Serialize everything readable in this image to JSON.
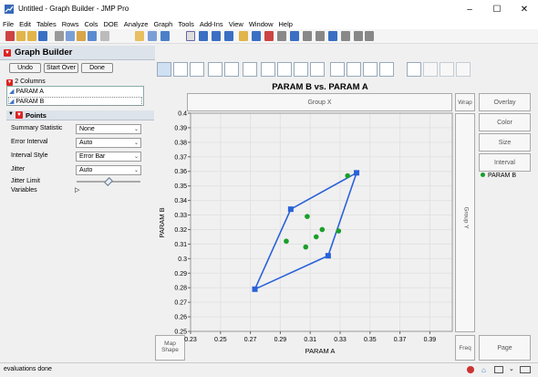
{
  "window": {
    "title": "Untitled - Graph Builder - JMP Pro"
  },
  "menu": [
    "File",
    "Edit",
    "Tables",
    "Rows",
    "Cols",
    "DOE",
    "Analyze",
    "Graph",
    "Tools",
    "Add-Ins",
    "View",
    "Window",
    "Help"
  ],
  "panel": {
    "title": "Graph Builder",
    "buttons": {
      "undo": "Undo",
      "start_over": "Start Over",
      "done": "Done"
    },
    "columns_header": "2 Columns",
    "columns": [
      "PARAM A",
      "PARAM B"
    ],
    "points_header": "Points",
    "options": [
      {
        "label": "Summary Statistic",
        "value": "None"
      },
      {
        "label": "Error Interval",
        "value": "Auto"
      },
      {
        "label": "Interval Style",
        "value": "Error Bar"
      },
      {
        "label": "Jitter",
        "value": "Auto"
      }
    ],
    "jitter_limit_label": "Jitter Limit",
    "jitter_limit": 0.5,
    "variables_label": "Variables"
  },
  "zones": {
    "group_x": "Group X",
    "group_y": "Group Y",
    "wrap": "Wrap",
    "overlay": "Overlay",
    "color": "Color",
    "size": "Size",
    "interval": "Interval",
    "map_shape": "Map Shape",
    "freq": "Freq",
    "page": "Page"
  },
  "legend": [
    {
      "name": "PARAM B",
      "color": "#1a9f2a"
    }
  ],
  "status": {
    "text": "evaluations done"
  },
  "chart_data": {
    "type": "scatter",
    "title": "PARAM B vs. PARAM A",
    "xlabel": "PARAM A",
    "ylabel": "PARAM B",
    "xlim": [
      0.23,
      0.405
    ],
    "ylim": [
      0.25,
      0.4
    ],
    "xticks": [
      "0.23",
      "0.25",
      "0.27",
      "0.29",
      "0.31",
      "0.33",
      "0.35",
      "0.37",
      "0.39"
    ],
    "yticks": [
      "0.25",
      "0.26",
      "0.27",
      "0.28",
      "0.29",
      "0.3",
      "0.31",
      "0.32",
      "0.33",
      "0.34",
      "0.35",
      "0.36",
      "0.37",
      "0.38",
      "0.39",
      "0.4"
    ],
    "grid": true,
    "series": [
      {
        "name": "PARAM B",
        "color": "#1a9f2a",
        "points": [
          [
            0.294,
            0.312
          ],
          [
            0.307,
            0.308
          ],
          [
            0.308,
            0.329
          ],
          [
            0.314,
            0.315
          ],
          [
            0.318,
            0.32
          ],
          [
            0.329,
            0.319
          ],
          [
            0.335,
            0.357
          ]
        ]
      }
    ],
    "hull": {
      "color": "#2a62d9",
      "vertices": [
        [
          0.273,
          0.279
        ],
        [
          0.297,
          0.334
        ],
        [
          0.341,
          0.359
        ],
        [
          0.322,
          0.302
        ]
      ]
    }
  }
}
